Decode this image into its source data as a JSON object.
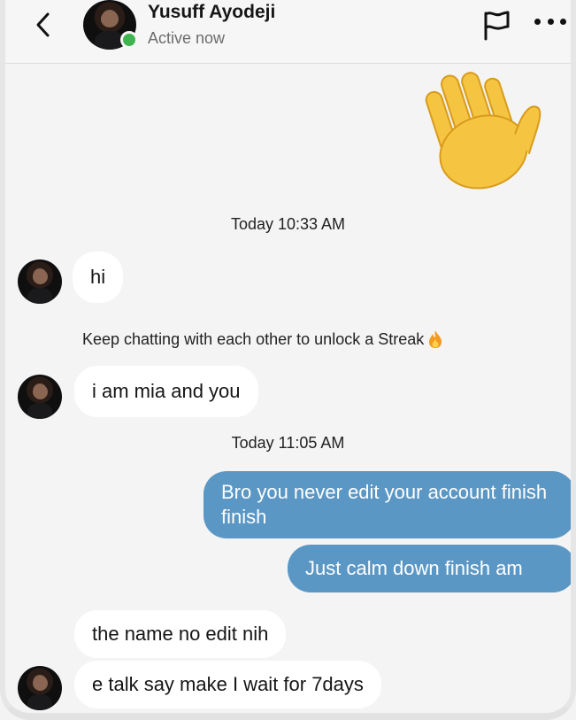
{
  "header": {
    "contact_name": "Yusuff Ayodeji",
    "status": "Active now"
  },
  "icons": {
    "back": "chevron-left-icon",
    "report": "flag-icon",
    "more": "more-horizontal-icon",
    "wave": "waving-hand-emoji",
    "streak": "fire-emoji",
    "online": "online-status-dot"
  },
  "colors": {
    "outgoing_bubble": "#5b97c5",
    "incoming_bubble": "#ffffff",
    "online_dot": "#3fb34f",
    "background": "#f4f4f4"
  },
  "conversation": {
    "timestamp_1": "Today 10:33 AM",
    "timestamp_2": "Today 11:05 AM",
    "streak_note": "Keep chatting with each other to unlock a Streak",
    "messages": [
      {
        "direction": "incoming",
        "text": "hi"
      },
      {
        "direction": "incoming",
        "text": "i am mia and you"
      },
      {
        "direction": "outgoing",
        "text": "Bro you never edit your account finish finish"
      },
      {
        "direction": "outgoing",
        "text": "Just calm down finish am"
      },
      {
        "direction": "incoming",
        "text": "the name no edit nih"
      },
      {
        "direction": "incoming",
        "text": "e talk say make I wait for 7days"
      }
    ]
  }
}
